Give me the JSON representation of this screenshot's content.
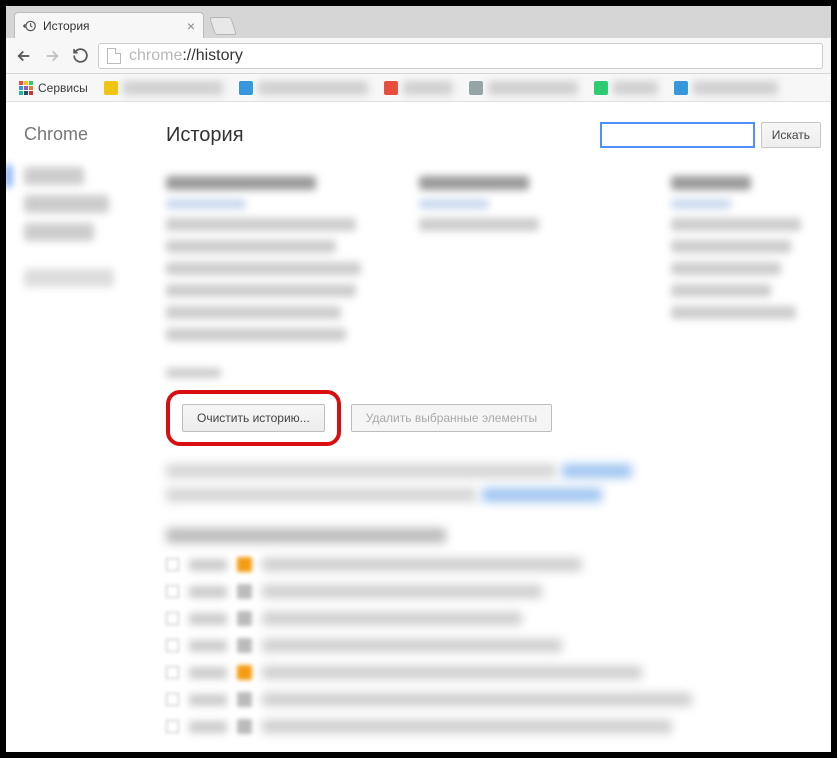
{
  "tab": {
    "title": "История"
  },
  "omnibox": {
    "scheme": "chrome",
    "rest": "://history"
  },
  "bookmarks": {
    "apps_label": "Сервисы"
  },
  "sidebar": {
    "brand": "Chrome"
  },
  "page": {
    "title": "История",
    "search_button": "Искать",
    "clear_button": "Очистить историю...",
    "delete_selected_button": "Удалить выбранные элементы"
  }
}
